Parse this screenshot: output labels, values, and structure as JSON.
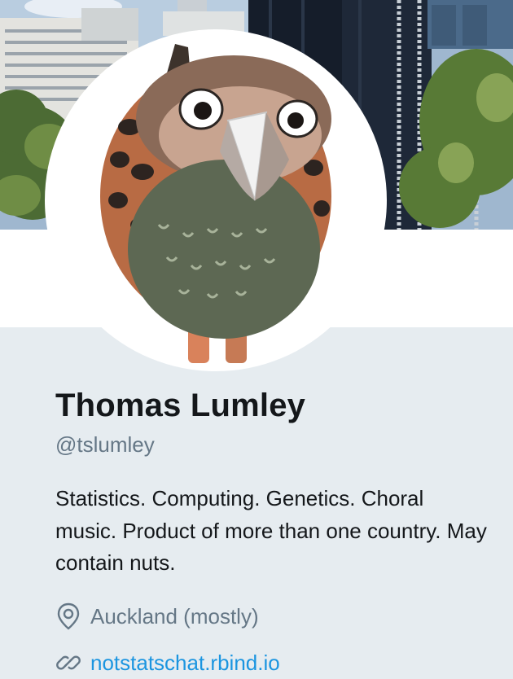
{
  "profile": {
    "name": "Thomas Lumley",
    "handle": "@tslumley",
    "bio": "Statistics. Computing. Genetics. Choral music. Product of more than one country. May contain nuts.",
    "location": "Auckland (mostly)",
    "website": "notstatschat.rbind.io"
  },
  "icons": {
    "location": "map-pin-icon",
    "website": "link-icon"
  },
  "colors": {
    "link": "#1b95e0",
    "secondary_text": "#657786",
    "primary_text": "#14171a",
    "page_background": "#e6ecf0"
  }
}
